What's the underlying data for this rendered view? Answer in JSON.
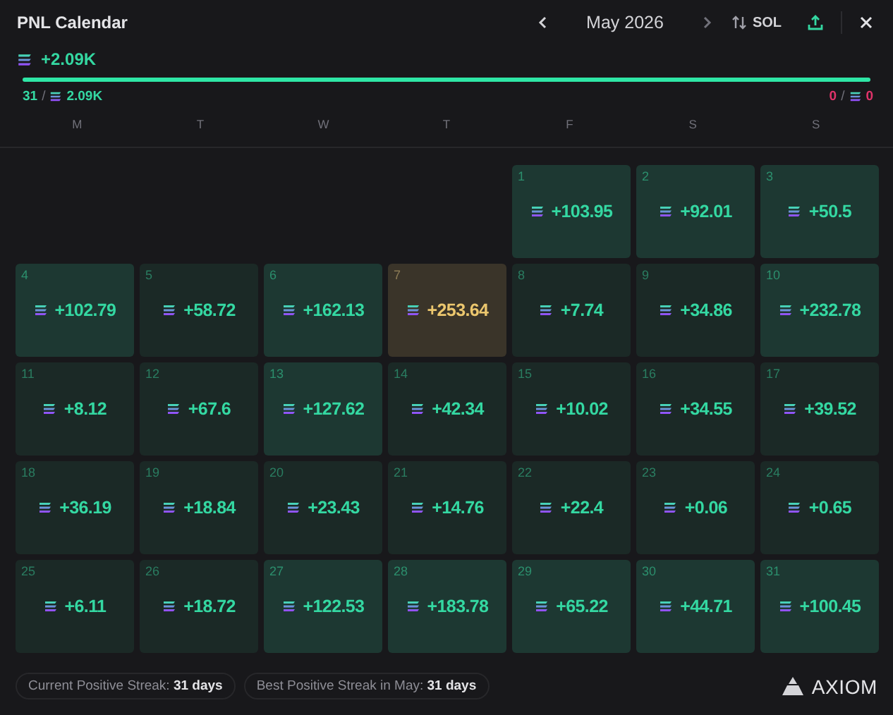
{
  "header": {
    "title": "PNL Calendar",
    "month": "May 2026",
    "currency": "SOL"
  },
  "summary": {
    "total": "+2.09K",
    "level": 1,
    "wins": "31",
    "separator": "/",
    "win_amount": "2.09K",
    "losses": "0",
    "loss_amount": "0"
  },
  "weekdays": [
    "M",
    "T",
    "W",
    "T",
    "F",
    "S",
    "S"
  ],
  "weeks": [
    [
      {
        "kind": "blank"
      },
      {
        "kind": "blank"
      },
      {
        "kind": "blank"
      },
      {
        "kind": "blank"
      },
      {
        "kind": "high",
        "day": "1",
        "value": "+103.95"
      },
      {
        "kind": "high",
        "day": "2",
        "value": "+92.01"
      },
      {
        "kind": "high",
        "day": "3",
        "value": "+50.5"
      }
    ],
    [
      {
        "kind": "high",
        "day": "4",
        "value": "+102.79"
      },
      {
        "kind": "low",
        "day": "5",
        "value": "+58.72"
      },
      {
        "kind": "high",
        "day": "6",
        "value": "+162.13"
      },
      {
        "kind": "best",
        "day": "7",
        "value": "+253.64"
      },
      {
        "kind": "low",
        "day": "8",
        "value": "+7.74"
      },
      {
        "kind": "low",
        "day": "9",
        "value": "+34.86"
      },
      {
        "kind": "high",
        "day": "10",
        "value": "+232.78"
      }
    ],
    [
      {
        "kind": "low",
        "day": "11",
        "value": "+8.12"
      },
      {
        "kind": "low",
        "day": "12",
        "value": "+67.6"
      },
      {
        "kind": "high",
        "day": "13",
        "value": "+127.62"
      },
      {
        "kind": "low",
        "day": "14",
        "value": "+42.34"
      },
      {
        "kind": "low",
        "day": "15",
        "value": "+10.02"
      },
      {
        "kind": "low",
        "day": "16",
        "value": "+34.55"
      },
      {
        "kind": "low",
        "day": "17",
        "value": "+39.52"
      }
    ],
    [
      {
        "kind": "low",
        "day": "18",
        "value": "+36.19"
      },
      {
        "kind": "low",
        "day": "19",
        "value": "+18.84"
      },
      {
        "kind": "low",
        "day": "20",
        "value": "+23.43"
      },
      {
        "kind": "low",
        "day": "21",
        "value": "+14.76"
      },
      {
        "kind": "low",
        "day": "22",
        "value": "+22.4"
      },
      {
        "kind": "low",
        "day": "23",
        "value": "+0.06"
      },
      {
        "kind": "low",
        "day": "24",
        "value": "+0.65"
      }
    ],
    [
      {
        "kind": "low",
        "day": "25",
        "value": "+6.11"
      },
      {
        "kind": "low",
        "day": "26",
        "value": "+18.72"
      },
      {
        "kind": "high",
        "day": "27",
        "value": "+122.53"
      },
      {
        "kind": "high",
        "day": "28",
        "value": "+183.78"
      },
      {
        "kind": "high",
        "day": "29",
        "value": "+65.22"
      },
      {
        "kind": "high",
        "day": "30",
        "value": "+44.71"
      },
      {
        "kind": "high",
        "day": "31",
        "value": "+100.45"
      }
    ]
  ],
  "footer": {
    "streaks": [
      {
        "label": "Current Positive Streak:",
        "value": "31 days"
      },
      {
        "label": "Best Positive Streak in May:",
        "value": "31 days"
      }
    ],
    "logo": "AXIOM"
  }
}
